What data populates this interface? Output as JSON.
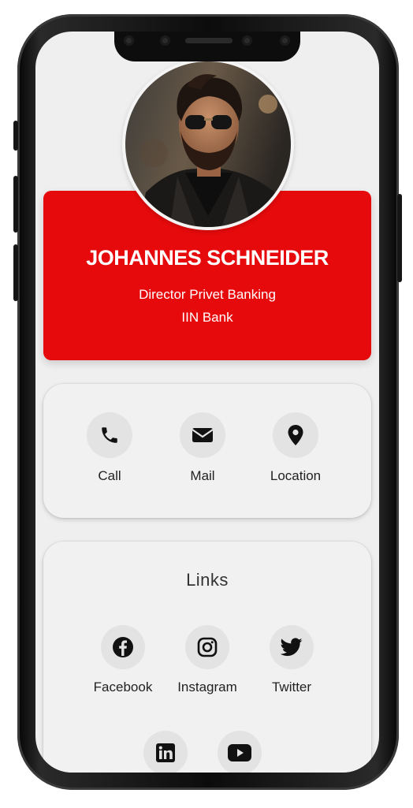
{
  "profile": {
    "name": "JOHANNES SCHNEIDER",
    "job_title": "Director Privet Banking",
    "company": "IIN Bank"
  },
  "actions": [
    {
      "label": "Call",
      "icon": "phone-icon"
    },
    {
      "label": "Mail",
      "icon": "mail-icon"
    },
    {
      "label": "Location",
      "icon": "location-pin-icon"
    }
  ],
  "links": {
    "title": "Links",
    "items": [
      {
        "label": "Facebook",
        "icon": "facebook-icon"
      },
      {
        "label": "Instagram",
        "icon": "instagram-icon"
      },
      {
        "label": "Twitter",
        "icon": "twitter-icon"
      },
      {
        "label": "",
        "icon": "linkedin-icon"
      },
      {
        "label": "",
        "icon": "youtube-icon"
      }
    ]
  },
  "colors": {
    "brand_red": "#e60a0c",
    "background": "#efefef",
    "icon_circle": "#e3e3e3",
    "icon": "#111111"
  }
}
